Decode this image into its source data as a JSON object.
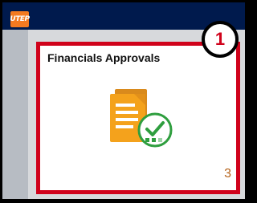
{
  "header": {
    "logo_text": "UTEP"
  },
  "tile": {
    "title": "Financials Approvals",
    "count": "3",
    "icon": "document-approval-icon"
  },
  "annotation": {
    "step": "1"
  },
  "colors": {
    "header_bg": "#001a4d",
    "logo_orange": "#f47a20",
    "highlight_red": "#d0021b",
    "count_text": "#b5631b",
    "check_green": "#2e9e3e"
  }
}
